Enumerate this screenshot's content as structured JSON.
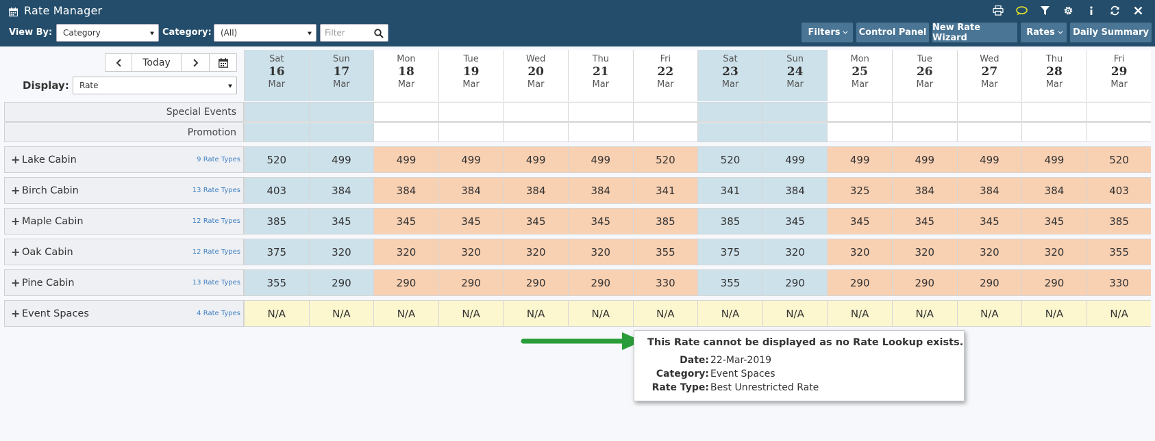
{
  "app": {
    "title": "Rate Manager",
    "icon": "calendar-icon"
  },
  "title_tools": [
    "print-icon",
    "chat-icon",
    "filter-icon",
    "gear-icon",
    "info-icon",
    "refresh-icon",
    "close-icon"
  ],
  "toolbar": {
    "view_by_label": "View By:",
    "view_by_value": "Category",
    "category_label": "Category:",
    "category_value": "(All)",
    "filter_placeholder": "Filter",
    "buttons": {
      "filters": "Filters",
      "control_panel": "Control Panel",
      "new_rate_wizard": "New Rate Wizard",
      "rates": "Rates",
      "daily_summary": "Daily Summary"
    }
  },
  "nav": {
    "today": "Today"
  },
  "display": {
    "label": "Display:",
    "value": "Rate"
  },
  "days": [
    {
      "dow": "Sat",
      "dom": "16",
      "mon": "Mar",
      "weekend": true
    },
    {
      "dow": "Sun",
      "dom": "17",
      "mon": "Mar",
      "weekend": true
    },
    {
      "dow": "Mon",
      "dom": "18",
      "mon": "Mar",
      "weekend": false
    },
    {
      "dow": "Tue",
      "dom": "19",
      "mon": "Mar",
      "weekend": false
    },
    {
      "dow": "Wed",
      "dom": "20",
      "mon": "Mar",
      "weekend": false
    },
    {
      "dow": "Thu",
      "dom": "21",
      "mon": "Mar",
      "weekend": false
    },
    {
      "dow": "Fri",
      "dom": "22",
      "mon": "Mar",
      "weekend": false
    },
    {
      "dow": "Sat",
      "dom": "23",
      "mon": "Mar",
      "weekend": true
    },
    {
      "dow": "Sun",
      "dom": "24",
      "mon": "Mar",
      "weekend": true
    },
    {
      "dow": "Mon",
      "dom": "25",
      "mon": "Mar",
      "weekend": false
    },
    {
      "dow": "Tue",
      "dom": "26",
      "mon": "Mar",
      "weekend": false
    },
    {
      "dow": "Wed",
      "dom": "27",
      "mon": "Mar",
      "weekend": false
    },
    {
      "dow": "Thu",
      "dom": "28",
      "mon": "Mar",
      "weekend": false
    },
    {
      "dow": "Fri",
      "dom": "29",
      "mon": "Mar",
      "weekend": false
    }
  ],
  "info_rows": [
    "Special Events",
    "Promotion"
  ],
  "categories": [
    {
      "name": "Lake Cabin",
      "types": "9 Rate Types",
      "rates": [
        "520",
        "499",
        "499",
        "499",
        "499",
        "499",
        "520",
        "520",
        "499",
        "499",
        "499",
        "499",
        "499",
        "520"
      ],
      "style": [
        "we",
        "we",
        "wd",
        "wd",
        "wd",
        "wd",
        "wd",
        "we",
        "we",
        "wd",
        "wd",
        "wd",
        "wd",
        "wd"
      ]
    },
    {
      "name": "Birch Cabin",
      "types": "13 Rate Types",
      "rates": [
        "403",
        "384",
        "384",
        "384",
        "384",
        "384",
        "341",
        "341",
        "384",
        "325",
        "384",
        "384",
        "384",
        "403"
      ],
      "style": [
        "we",
        "we",
        "wd",
        "wd",
        "wd",
        "wd",
        "wd",
        "we",
        "we",
        "wd",
        "wd",
        "wd",
        "wd",
        "wd"
      ]
    },
    {
      "name": "Maple Cabin",
      "types": "12 Rate Types",
      "rates": [
        "385",
        "345",
        "345",
        "345",
        "345",
        "345",
        "385",
        "385",
        "345",
        "345",
        "345",
        "345",
        "345",
        "385"
      ],
      "style": [
        "we",
        "we",
        "wd",
        "wd",
        "wd",
        "wd",
        "wd",
        "we",
        "we",
        "wd",
        "wd",
        "wd",
        "wd",
        "wd"
      ]
    },
    {
      "name": "Oak Cabin",
      "types": "12 Rate Types",
      "rates": [
        "375",
        "320",
        "320",
        "320",
        "320",
        "320",
        "355",
        "375",
        "320",
        "320",
        "320",
        "320",
        "320",
        "355"
      ],
      "style": [
        "we",
        "we",
        "wd",
        "wd",
        "wd",
        "wd",
        "wd",
        "we",
        "we",
        "wd",
        "wd",
        "wd",
        "wd",
        "wd"
      ]
    },
    {
      "name": "Pine Cabin",
      "types": "13 Rate Types",
      "rates": [
        "355",
        "290",
        "290",
        "290",
        "290",
        "290",
        "330",
        "355",
        "290",
        "290",
        "290",
        "290",
        "290",
        "330"
      ],
      "style": [
        "we",
        "we",
        "wd",
        "wd",
        "wd",
        "wd",
        "wd",
        "we",
        "we",
        "wd",
        "wd",
        "wd",
        "wd",
        "wd"
      ]
    },
    {
      "name": "Event Spaces",
      "types": "4 Rate Types",
      "rates": [
        "N/A",
        "N/A",
        "N/A",
        "N/A",
        "N/A",
        "N/A",
        "N/A",
        "N/A",
        "N/A",
        "N/A",
        "N/A",
        "N/A",
        "N/A",
        "N/A"
      ],
      "style": [
        "na",
        "na",
        "na",
        "na",
        "na",
        "na",
        "na",
        "na",
        "na",
        "na",
        "na",
        "na",
        "na",
        "na"
      ]
    }
  ],
  "tooltip": {
    "title": "This Rate cannot be displayed as no Rate Lookup exists.",
    "rows": [
      {
        "key": "Date:",
        "value": "22-Mar-2019"
      },
      {
        "key": "Category:",
        "value": "Event Spaces"
      },
      {
        "key": "Rate Type:",
        "value": "Best Unrestricted Rate"
      }
    ]
  },
  "colors": {
    "header": "#234d6b",
    "weekend_cell": "#cde1ea",
    "weekday_cell": "#f8d0b2",
    "na_cell": "#fdf7cf",
    "arrow": "#2a9d3a",
    "link": "#3f7fc0"
  }
}
